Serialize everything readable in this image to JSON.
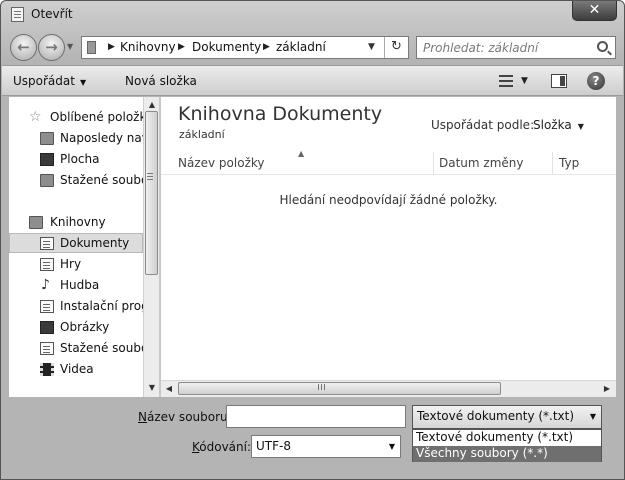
{
  "window": {
    "title": "Otevřít",
    "close_label": "✕"
  },
  "nav": {
    "back_label": "←",
    "forward_label": "→",
    "breadcrumbs": [
      "Knihovny",
      "Dokumenty",
      "základní"
    ],
    "refresh_label": "↻"
  },
  "search": {
    "placeholder": "Prohledat: základní"
  },
  "toolbar": {
    "organize_label": "Uspořádat",
    "new_folder_label": "Nová složka",
    "help_label": "?"
  },
  "sidebar": {
    "items": [
      {
        "label": "Oblíbené položky",
        "icon": "star-icon",
        "indent": 0
      },
      {
        "label": "Naposledy navštívené",
        "icon": "recent-places-icon",
        "indent": 1
      },
      {
        "label": "Plocha",
        "icon": "desktop-icon",
        "indent": 1
      },
      {
        "label": "Stažené soubory",
        "icon": "downloads-icon",
        "indent": 1
      },
      {
        "label": "Knihovny",
        "icon": "libraries-icon",
        "indent": 0
      },
      {
        "label": "Dokumenty",
        "icon": "documents-icon",
        "indent": 1,
        "selected": true
      },
      {
        "label": "Hry",
        "icon": "games-icon",
        "indent": 1
      },
      {
        "label": "Hudba",
        "icon": "music-icon",
        "indent": 1
      },
      {
        "label": "Instalační programy",
        "icon": "installers-icon",
        "indent": 1
      },
      {
        "label": "Obrázky",
        "icon": "pictures-icon",
        "indent": 1
      },
      {
        "label": "Stažené soubory",
        "icon": "downloads-icon",
        "indent": 1
      },
      {
        "label": "Videa",
        "icon": "videos-icon",
        "indent": 1
      }
    ]
  },
  "content": {
    "library_title": "Knihovna Dokumenty",
    "library_subtitle": "základní",
    "arrange_by_label": "Uspořádat podle:",
    "arrange_by_value": "Složka",
    "columns": [
      "Název položky",
      "Datum změny",
      "Typ"
    ],
    "empty_message": "Hledání neodpovídají žádné položky."
  },
  "bottom": {
    "filename_label_u": "N",
    "filename_label_rest": "ázev souboru:",
    "filename_value": "",
    "filetype_selected": "Textové dokumenty (*.txt)",
    "filetype_options": [
      "Textové dokumenty (*.txt)",
      "Všechny soubory  (*.*)"
    ],
    "filetype_highlighted_index": 1,
    "encoding_label_u": "K",
    "encoding_label_rest": "ódování:",
    "encoding_value": "UTF-8"
  },
  "colors": {
    "selection_bg": "#dcdcdc",
    "dropdown_highlight": "#6f6f6f"
  }
}
